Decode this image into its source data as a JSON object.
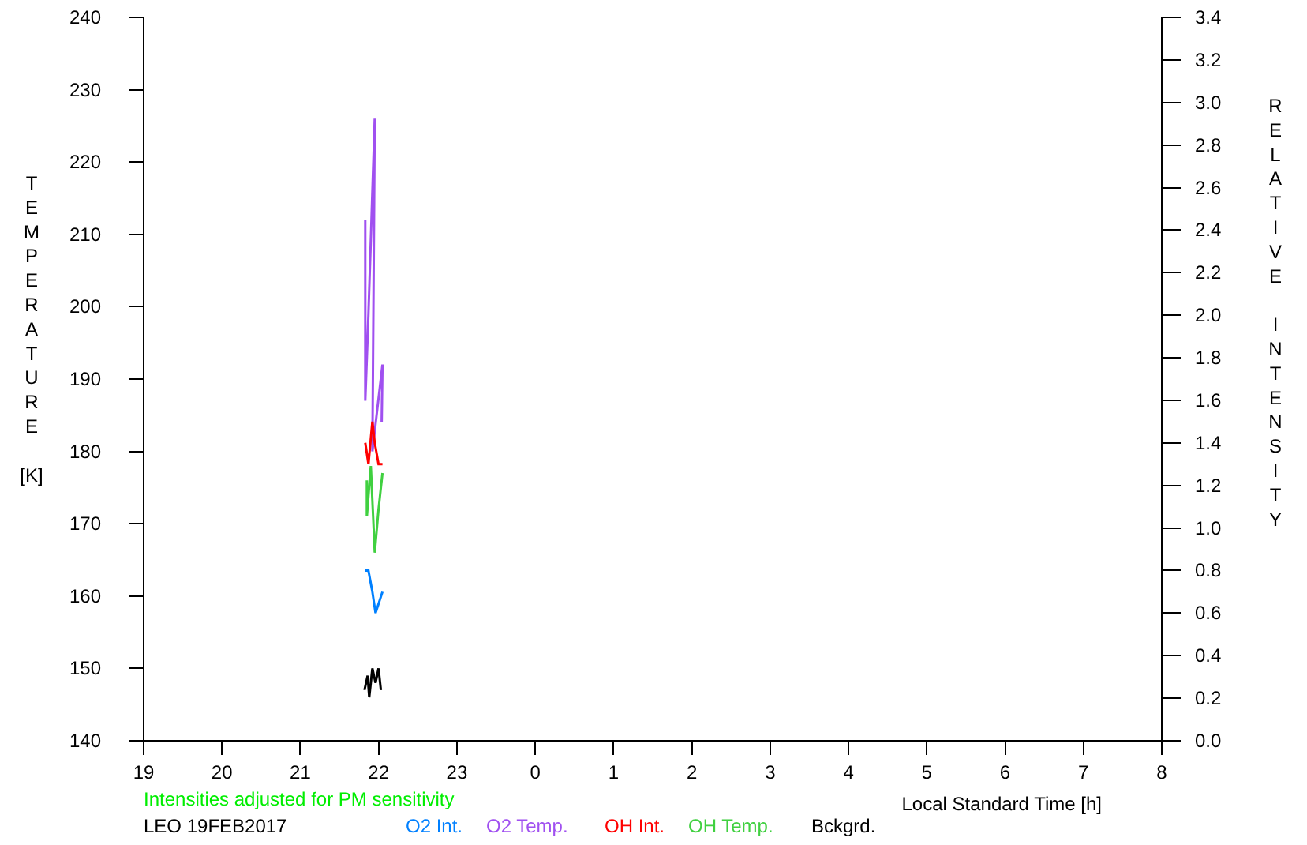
{
  "chart_data": {
    "type": "line",
    "xlabel": "Local Standard Time [h]",
    "ylabel": "TEMPERATURE [K]",
    "y2label": "RELATIVE INTENSITY",
    "xlim": [
      19,
      32
    ],
    "xticks": [
      19,
      20,
      21,
      22,
      23
    ],
    "ylim": [
      140,
      240
    ],
    "yticks": [
      140,
      150,
      160,
      170,
      180,
      190,
      200,
      210,
      220,
      230,
      240
    ],
    "y2lim": [
      0,
      3.4
    ],
    "y2ticks": [
      {
        "value": 0,
        "label": "0.0"
      },
      {
        "value": 0.2,
        "label": "0.2"
      },
      {
        "value": 0.4,
        "label": "0.4"
      },
      {
        "value": 0.6,
        "label": "0.6"
      },
      {
        "value": 0.8,
        "label": "0.8"
      },
      {
        "value": 1,
        "label": "1.0"
      },
      {
        "value": 1.2,
        "label": "1.2"
      },
      {
        "value": 1.4,
        "label": "1.4"
      },
      {
        "value": 1.6,
        "label": "1.6"
      },
      {
        "value": 1.8,
        "label": "1.8"
      },
      {
        "value": 2,
        "label": "2.0"
      },
      {
        "value": 2.2,
        "label": "2.2"
      },
      {
        "value": 2.4,
        "label": "2.4"
      },
      {
        "value": 2.6,
        "label": "2.6"
      },
      {
        "value": 2.8,
        "label": "2.8"
      },
      {
        "value": 3,
        "label": "3.0"
      },
      {
        "value": 3.2,
        "label": "3.2"
      },
      {
        "value": 3.4,
        "label": "3.4"
      }
    ],
    "series": [
      {
        "name": "O2 Int.",
        "color": "#0080ff",
        "axis": "y2",
        "x": [
          21.83,
          21.87,
          21.92,
          21.96,
          22.05
        ],
        "values": [
          0.8,
          0.8,
          0.7,
          0.6,
          0.7
        ]
      },
      {
        "name": "O2 Temp.",
        "color": "#a050f0",
        "x": [
          21.83,
          21.83,
          21.87,
          21.95,
          21.92,
          22.05,
          22.04
        ],
        "values": [
          212,
          187,
          199,
          226,
          180,
          192,
          184
        ]
      },
      {
        "name": "OH Int.",
        "color": "#ff0000",
        "axis": "y2",
        "x": [
          21.83,
          21.87,
          21.92,
          21.95,
          22.0,
          22.05
        ],
        "values": [
          1.4,
          1.3,
          1.5,
          1.4,
          1.3,
          1.3
        ]
      },
      {
        "name": "OH Temp.",
        "color": "#40d040",
        "x": [
          21.85,
          21.85,
          21.9,
          21.95,
          22.0,
          22.05
        ],
        "values": [
          176,
          171,
          178,
          166,
          172,
          177
        ]
      },
      {
        "name": "Bckgrd.",
        "color": "#000000",
        "x": [
          21.82,
          21.86,
          21.88,
          21.92,
          21.96,
          22.0,
          22.03
        ],
        "values": [
          147,
          149,
          146,
          150,
          148,
          150,
          147
        ]
      }
    ]
  },
  "after_midnight_hour_labels": [
    "0",
    "1",
    "2",
    "3",
    "4",
    "5",
    "6",
    "7",
    "8"
  ],
  "note": "Intensities adjusted for PM sensitivity",
  "station_date": "LEO 19FEB2017"
}
